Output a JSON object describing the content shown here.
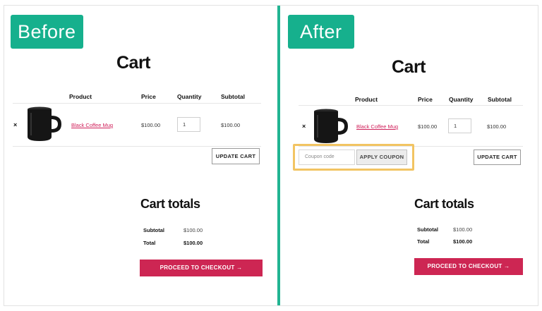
{
  "before": {
    "badge": "Before",
    "cart_title": "Cart",
    "columns": {
      "product": "Product",
      "price": "Price",
      "quantity": "Quantity",
      "subtotal": "Subtotal"
    },
    "item": {
      "remove": "×",
      "name": "Black Coffee Mug",
      "price": "$100.00",
      "quantity": "1",
      "subtotal": "$100.00"
    },
    "update_cart": "UPDATE CART",
    "totals": {
      "title": "Cart totals",
      "subtotal_label": "Subtotal",
      "subtotal_value": "$100.00",
      "total_label": "Total",
      "total_value": "$100.00"
    },
    "checkout": "PROCEED TO CHECKOUT →"
  },
  "after": {
    "badge": "After",
    "cart_title": "Cart",
    "columns": {
      "product": "Product",
      "price": "Price",
      "quantity": "Quantity",
      "subtotal": "Subtotal"
    },
    "item": {
      "remove": "×",
      "name": "Black Coffee Mug",
      "price": "$100.00",
      "quantity": "1",
      "subtotal": "$100.00"
    },
    "coupon": {
      "placeholder": "Coupon code",
      "apply": "APPLY COUPON"
    },
    "update_cart": "UPDATE CART",
    "totals": {
      "title": "Cart totals",
      "subtotal_label": "Subtotal",
      "subtotal_value": "$100.00",
      "total_label": "Total",
      "total_value": "$100.00"
    },
    "checkout": "PROCEED TO CHECKOUT →"
  },
  "colors": {
    "badge": "#16b08d",
    "divider": "#22b492",
    "accent": "#cd2653",
    "link": "#d0205a",
    "highlight": "#f2c462"
  }
}
